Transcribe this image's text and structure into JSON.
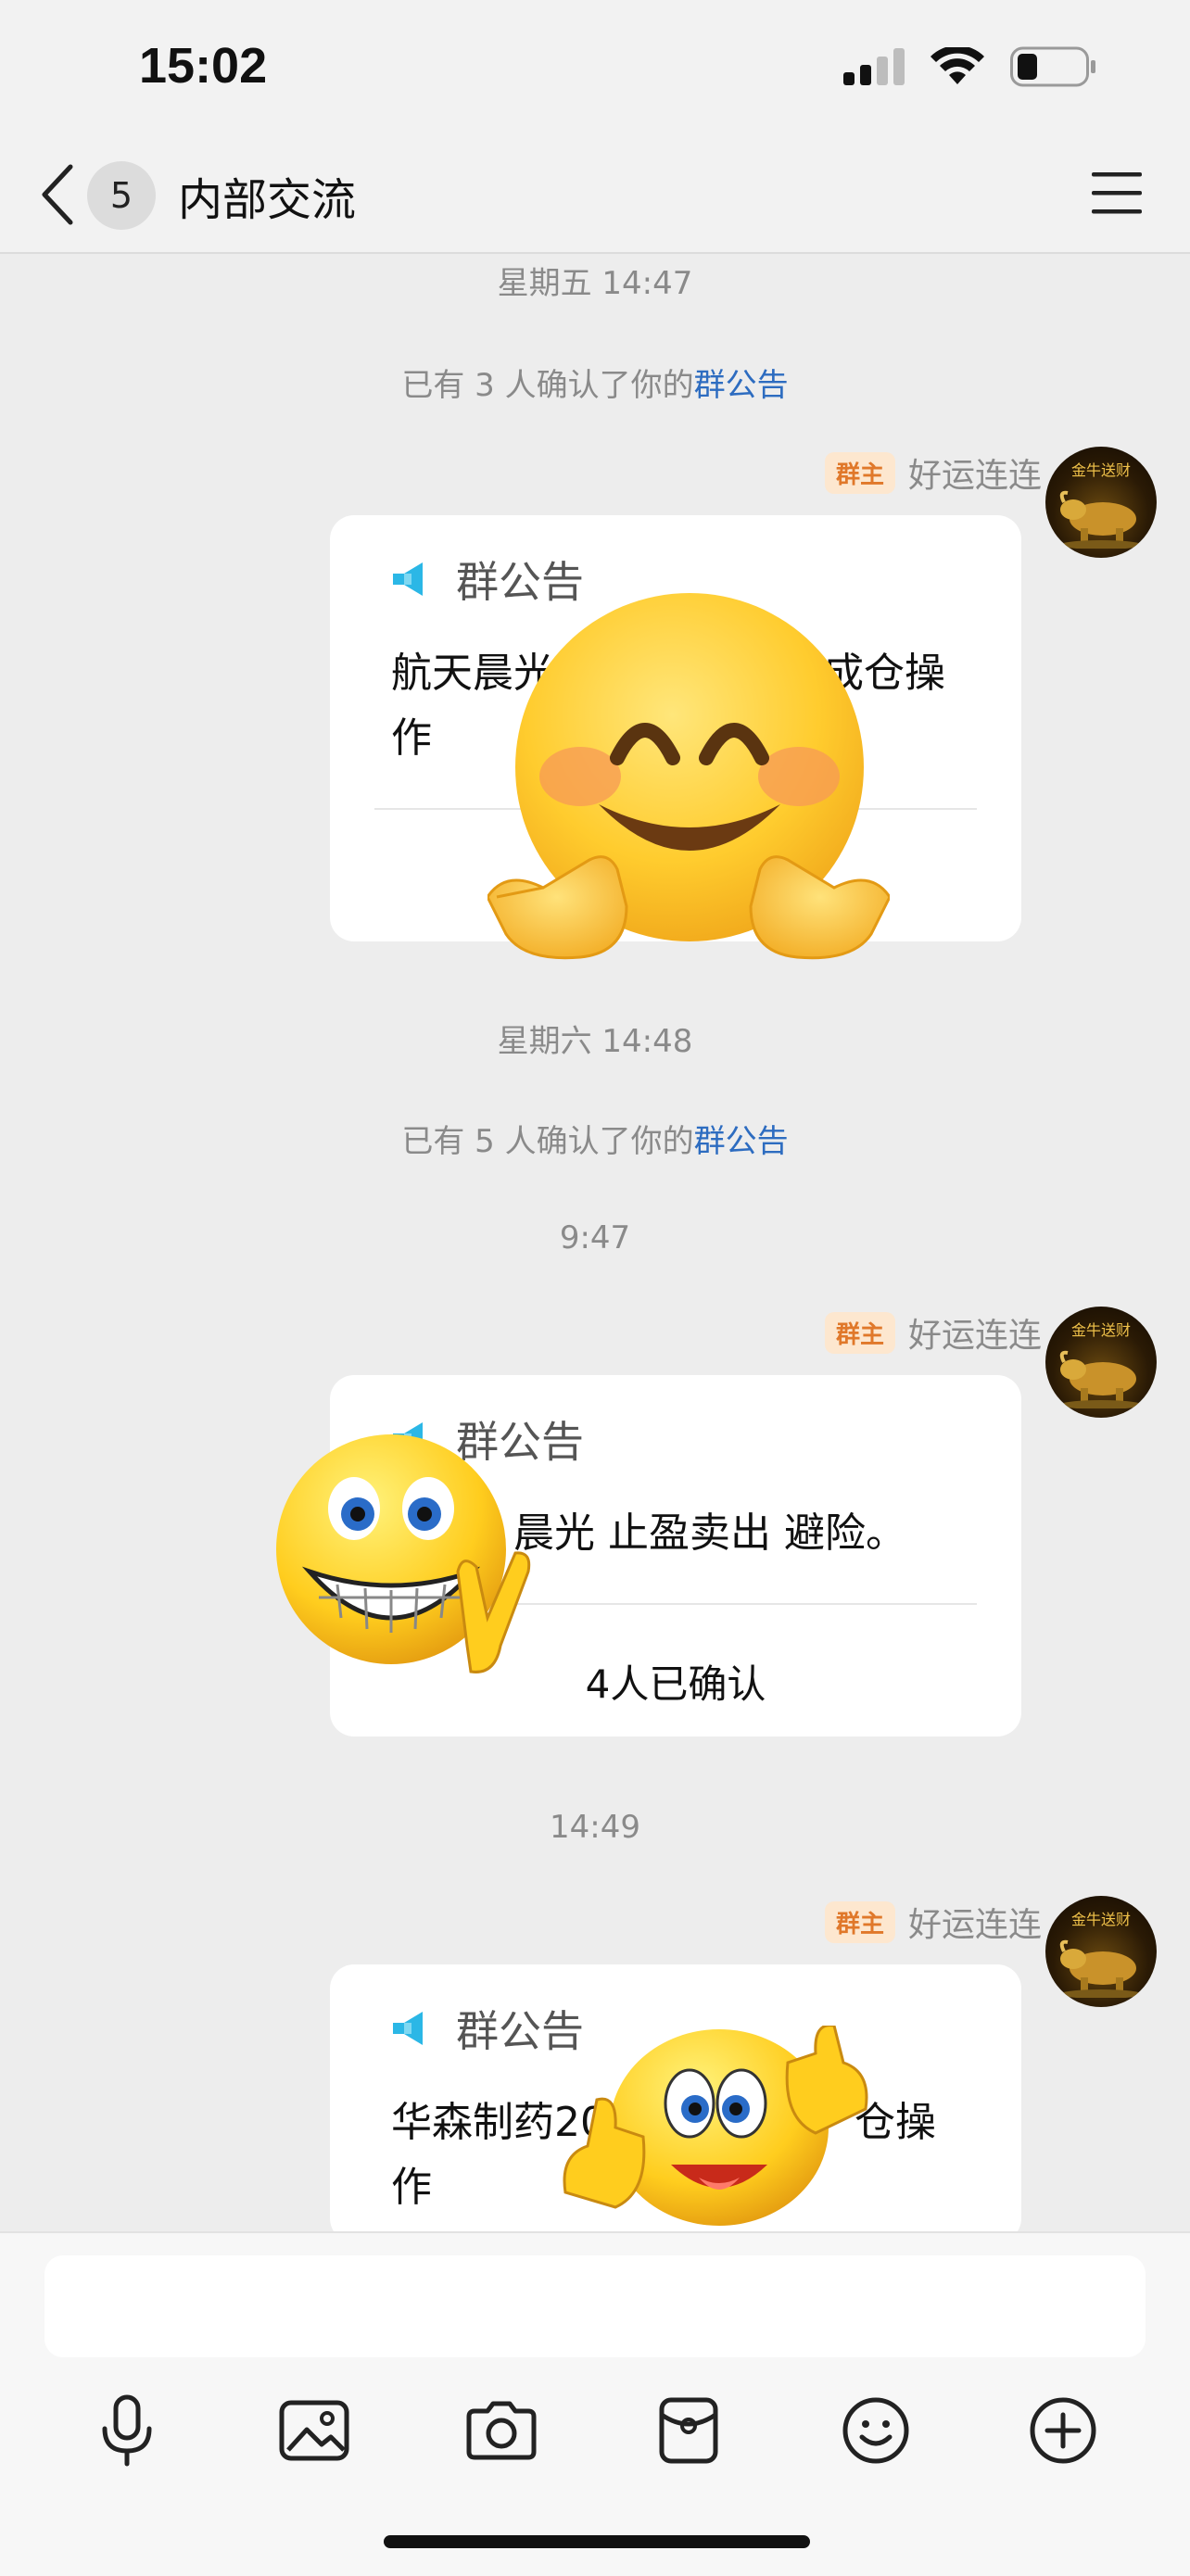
{
  "status_bar": {
    "time": "15:02",
    "battery_level": 0.3
  },
  "header": {
    "member_count": "5",
    "title": "内部交流"
  },
  "messages": [
    {
      "type": "time",
      "text": "星期五 14:47"
    },
    {
      "type": "notice",
      "prefix": "已有 3 人确认了你的",
      "link": "群公告"
    },
    {
      "type": "announcement",
      "badge": "群主",
      "sender": "好运连连",
      "avatar_text": "金牛送财",
      "card_label": "群公告",
      "body_line1": "航天晨光",
      "body_line1_tail": "成仓操",
      "body_line2": "作",
      "confirm": ""
    },
    {
      "type": "time",
      "text": "星期六 14:48"
    },
    {
      "type": "notice",
      "prefix": "已有 5 人确认了你的",
      "link": "群公告"
    },
    {
      "type": "time",
      "text": "9:47"
    },
    {
      "type": "announcement",
      "badge": "群主",
      "sender": "好运连连",
      "avatar_text": "金牛送财",
      "card_label": "群公告",
      "body_line1": "晨光 止盈卖出 避险。",
      "confirm": "4人已确认"
    },
    {
      "type": "time",
      "text": "14:49"
    },
    {
      "type": "announcement",
      "badge": "群主",
      "sender": "好运连连",
      "avatar_text": "金牛送财",
      "card_label": "群公告",
      "body_line1": "华森制药",
      "body_line1_mid": "202",
      "body_line1_tail": "仓操",
      "body_line2": "作"
    }
  ],
  "toolbar": {
    "items": [
      "microphone-icon",
      "image-icon",
      "camera-icon",
      "red-packet-icon",
      "emoji-icon",
      "plus-icon"
    ]
  },
  "colors": {
    "link": "#2d6cc0",
    "owner_badge_bg": "#fde7cf",
    "owner_badge_text": "#e0782a",
    "megaphone": "#2bb7e6"
  }
}
